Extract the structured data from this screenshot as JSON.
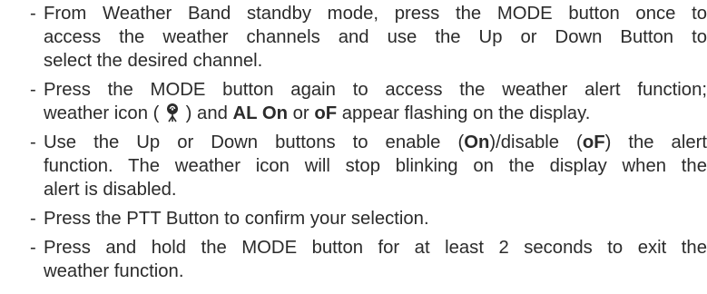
{
  "bullet": "-",
  "items": [
    {
      "lines": [
        "From Weather Band standby mode, press the MODE button once to",
        "access the weather channels and use the Up  or Down Button to",
        "select the desired channel."
      ]
    },
    {
      "line1": "Press the MODE button again to access the weather alert function;",
      "line2_a": "weather icon ( ",
      "icon": "weather-alert-icon",
      "line2_b": " ) and ",
      "bold1": "AL On",
      "line2_c": " or ",
      "bold2": "oF",
      "line2_d": " appear flashing on the display."
    },
    {
      "line1_a": "Use the Up or Down buttons to enable (",
      "bold_on": "On",
      "line1_b": ")/disable (",
      "bold_of": "oF",
      "line1_c": ") the alert",
      "line2": "function.  The weather icon will stop blinking on the display when the",
      "line3": "alert is disabled."
    },
    {
      "lines": [
        "Press the PTT Button to confirm your selection."
      ]
    },
    {
      "lines": [
        "Press and hold the MODE button for at least 2 seconds to exit the",
        "weather function."
      ]
    }
  ]
}
